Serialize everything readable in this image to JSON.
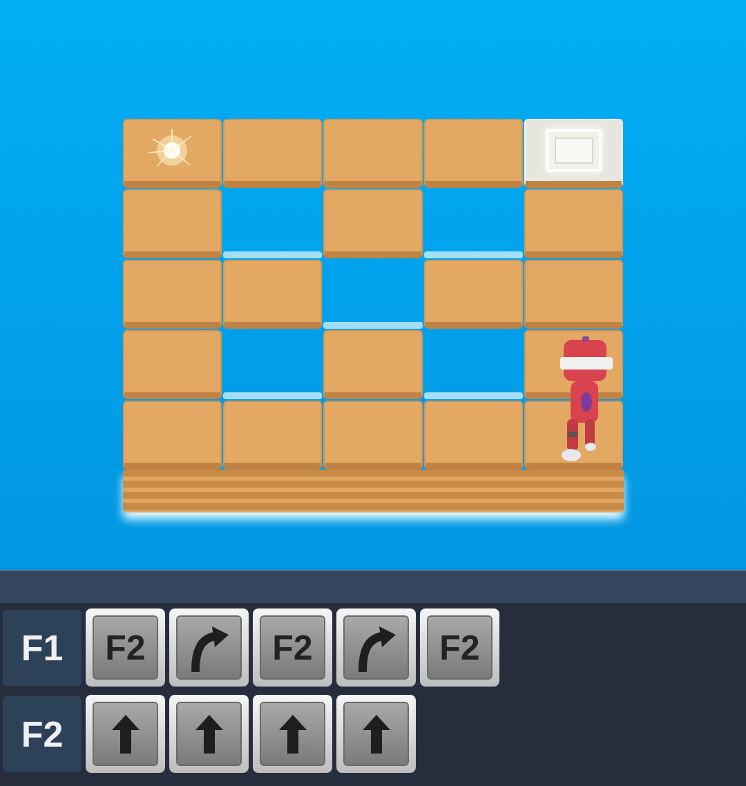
{
  "board": {
    "rows": [
      [
        "goal",
        "tile",
        "tile",
        "tile",
        "lit"
      ],
      [
        "tile",
        "hole",
        "tile",
        "hole",
        "tile"
      ],
      [
        "tile",
        "tile",
        "hole",
        "tile",
        "tile"
      ],
      [
        "tile",
        "hole",
        "tile",
        "hole",
        "tile"
      ],
      [
        "tile",
        "tile",
        "tile",
        "tile",
        "tile"
      ]
    ],
    "robot": {
      "row": 4,
      "col": 4,
      "facing": "up"
    }
  },
  "program": [
    {
      "label": "F1",
      "commands": [
        {
          "kind": "call",
          "text": "F2"
        },
        {
          "kind": "turn-right"
        },
        {
          "kind": "call",
          "text": "F2"
        },
        {
          "kind": "turn-right"
        },
        {
          "kind": "call",
          "text": "F2"
        }
      ]
    },
    {
      "label": "F2",
      "commands": [
        {
          "kind": "forward"
        },
        {
          "kind": "forward"
        },
        {
          "kind": "forward"
        },
        {
          "kind": "forward"
        }
      ]
    }
  ]
}
